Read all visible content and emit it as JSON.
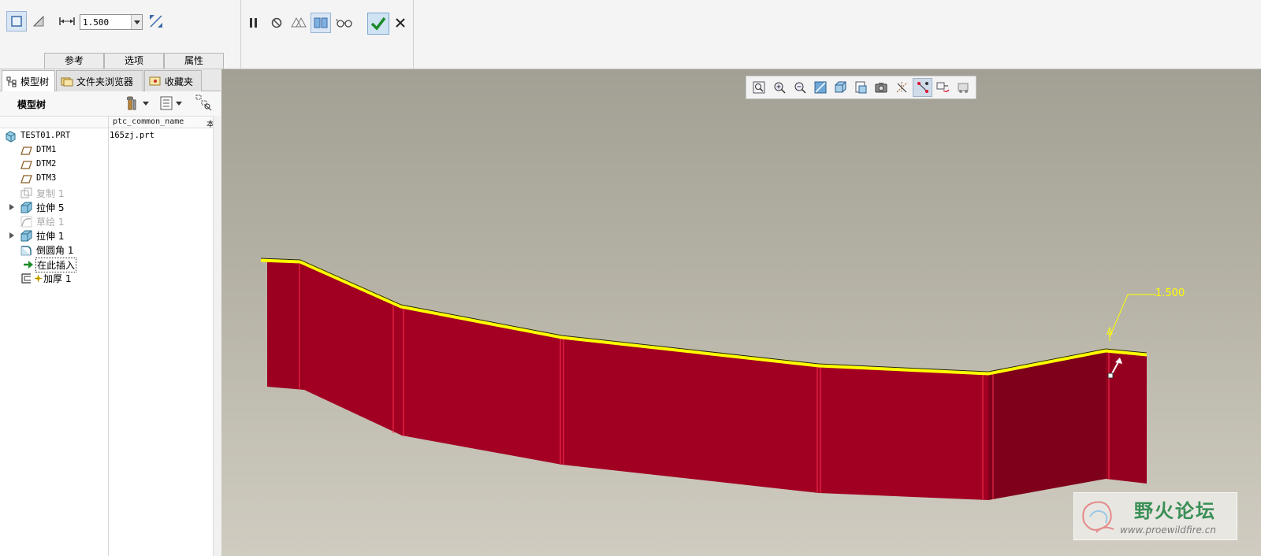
{
  "dashboard": {
    "thickness_value": "1.500",
    "tabs": [
      "参考",
      "选项",
      "属性"
    ]
  },
  "navigator": {
    "tabs": [
      {
        "label": "模型树",
        "icon": "model-tree-icon"
      },
      {
        "label": "文件夹浏览器",
        "icon": "folder-browser-icon"
      },
      {
        "label": "收藏夹",
        "icon": "favorites-icon"
      }
    ],
    "title": "模型树",
    "columns": [
      "ptc_common_name",
      "本"
    ],
    "rows": [
      {
        "label": "TEST01.PRT",
        "value": "165zj.prt",
        "icon": "part-icon"
      },
      {
        "label": "DTM1",
        "icon": "datum-plane-icon"
      },
      {
        "label": "DTM2",
        "icon": "datum-plane-icon"
      },
      {
        "label": "DTM3",
        "icon": "datum-plane-icon"
      },
      {
        "label": "复制 1",
        "icon": "copy-feature-icon"
      },
      {
        "label": "拉伸 5",
        "icon": "extrude-icon"
      },
      {
        "label": "草绘 1",
        "icon": "sketch-icon"
      },
      {
        "label": "拉伸 1",
        "icon": "extrude-icon"
      },
      {
        "label": "倒圆角 1",
        "icon": "round-icon"
      },
      {
        "label": "在此插入",
        "icon": "insert-here-arrow-icon"
      },
      {
        "label": "加厚 1",
        "icon": "thicken-icon"
      }
    ]
  },
  "graphics": {
    "dimension_value": "1.500"
  },
  "watermark": {
    "title": "野火论坛",
    "url": "www.proewildfire.cn"
  },
  "colors": {
    "model_red": "#a00020",
    "highlight_yellow": "#ffff00",
    "confirm_green": "#1e8c2a"
  }
}
